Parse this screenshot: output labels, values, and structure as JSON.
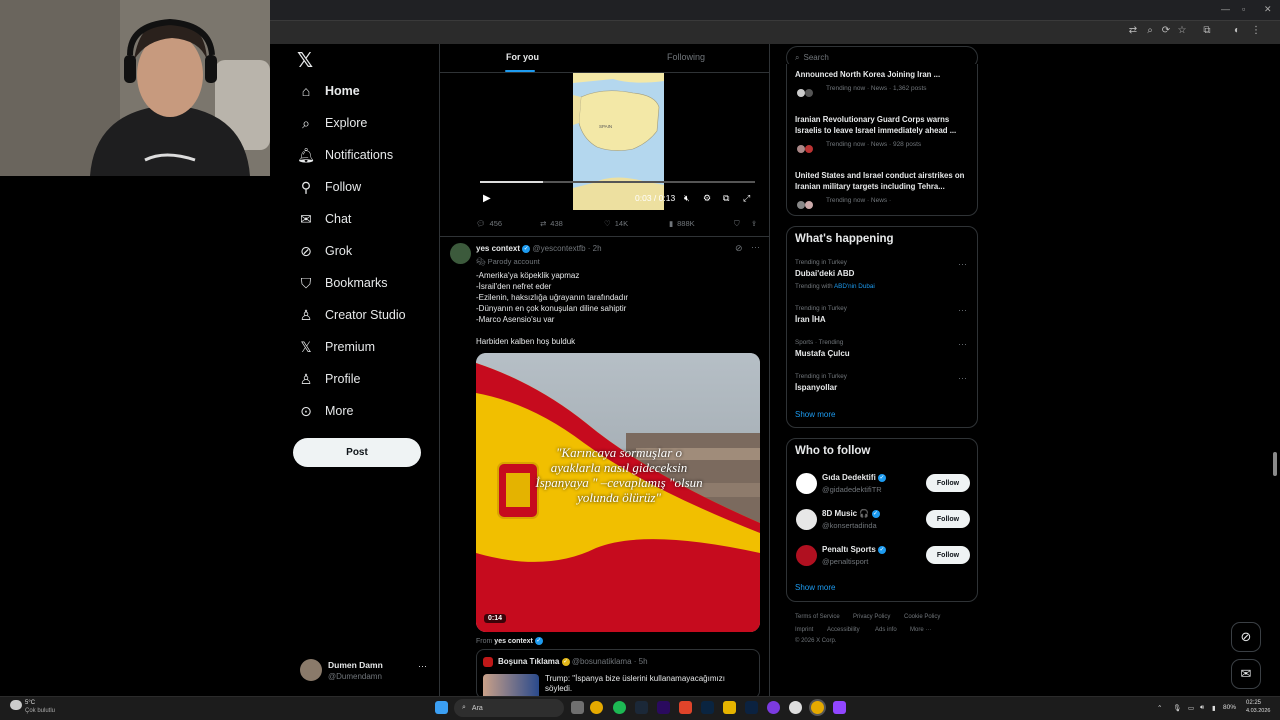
{
  "colors": {
    "accent": "#1d9bf0",
    "background": "#000000",
    "text": "#e7e9ea",
    "muted": "#71767b",
    "border": "#2f3336"
  },
  "left_nav": {
    "logo": "𝕏",
    "items": [
      {
        "label": "Home",
        "icon": "home-icon"
      },
      {
        "label": "Explore",
        "icon": "search-icon"
      },
      {
        "label": "Notifications",
        "icon": "bell-icon"
      },
      {
        "label": "Follow",
        "icon": "person-add-icon"
      },
      {
        "label": "Chat",
        "icon": "mail-icon"
      },
      {
        "label": "Grok",
        "icon": "grok-icon"
      },
      {
        "label": "Bookmarks",
        "icon": "bookmark-icon"
      },
      {
        "label": "Creator Studio",
        "icon": "creator-icon"
      },
      {
        "label": "Premium",
        "icon": "x-icon"
      },
      {
        "label": "Profile",
        "icon": "person-icon"
      },
      {
        "label": "More",
        "icon": "more-circle-icon"
      }
    ],
    "post_label": "Post",
    "account": {
      "name": "Dumen Damn",
      "handle": "@Dumendamn",
      "more": "···"
    }
  },
  "feed": {
    "tabs": [
      "For you",
      "Following"
    ],
    "video": {
      "time": "0:03 / 0:13",
      "progress": 0.23
    },
    "actions1": {
      "replies": "456",
      "reposts": "438",
      "likes": "14K",
      "views": "888K"
    },
    "tweet": {
      "name": "yes context",
      "handle": "@yescontextfb",
      "time": "· 2h",
      "badge": "Parody account",
      "lines": [
        "-Amerika'ya köpeklik yapmaz",
        "-İsrail'den nefret eder",
        "-Ezilenin, haksızlığa uğrayanın tarafındadır",
        "-Dünyanın en çok konuşulan diline sahiptir",
        "-Marco Asensio'su var"
      ],
      "closing": "Harbiden kalben hoş bulduk",
      "image_caption": "\"Karıncaya sormuşlar o ayaklarla nasıl gideceksin İspanyaya \" –cevaplamış \"olsun yolunda ölürüz\"",
      "duration": "0:14",
      "from_label": "From",
      "from_name": "yes context"
    },
    "quote": {
      "name": "Boşuna Tıklama",
      "handle": "@bosunatiklama",
      "time": "· 5h",
      "text": "Trump: \"İspanya bize üslerini kullanamayacağımızı söyledi."
    }
  },
  "right": {
    "search_placeholder": "Search",
    "news": [
      {
        "title": "Announced North Korea Joining Iran ...",
        "meta": "Trending now · News · 1,362 posts"
      },
      {
        "title": "Iranian Revolutionary Guard Corps warns Israelis to leave Israel immediately ahead ...",
        "meta": "Trending now · News · 928 posts"
      },
      {
        "title": "United States and Israel conduct airstrikes on Iranian military targets including Tehra...",
        "meta": "Trending now · News ·"
      }
    ],
    "happening": {
      "title": "What's happening",
      "items": [
        {
          "context": "Trending in Turkey",
          "name": "Dubai'deki ABD",
          "extra_prefix": "Trending with",
          "extra_link": "ABD'nin Dubai"
        },
        {
          "context": "Trending in Turkey",
          "name": "İran İHA"
        },
        {
          "context": "Sports · Trending",
          "name": "Mustafa Çulcu"
        },
        {
          "context": "Trending in Turkey",
          "name": "İspanyollar"
        }
      ],
      "show_more": "Show more"
    },
    "who_to_follow": {
      "title": "Who to follow",
      "users": [
        {
          "name": "Gıda Dedektifi",
          "handle": "@gidadedektifiTR",
          "button": "Follow"
        },
        {
          "name": "8D Music 🎧",
          "handle": "@konsertadinda",
          "button": "Follow"
        },
        {
          "name": "Penaltı Sports",
          "handle": "@penaltisport",
          "button": "Follow"
        }
      ],
      "show_more": "Show more"
    },
    "footer": [
      "Terms of Service",
      "Privacy Policy",
      "Cookie Policy",
      "Imprint",
      "Accessibility",
      "Ads info",
      "More ···",
      "© 2026 X Corp."
    ]
  },
  "taskbar": {
    "weather_temp": "5°C",
    "weather_desc": "Çok bulutlu",
    "search_placeholder": "Ara",
    "battery": "80%",
    "time": "02:25",
    "date": "4.03.2026"
  }
}
